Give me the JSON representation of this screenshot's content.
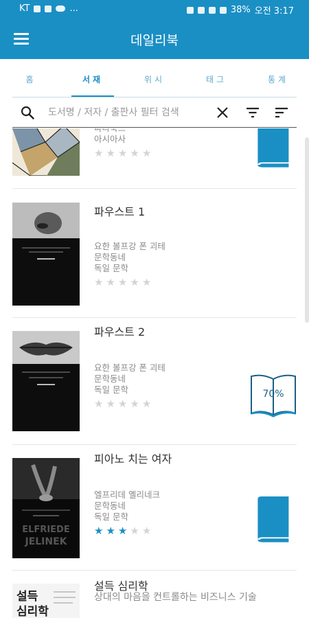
{
  "status": {
    "carrier": "KT",
    "more": "...",
    "battery": "38%",
    "time": "오전 3:17"
  },
  "app": {
    "title": "데일리북"
  },
  "tabs": [
    {
      "label": "홈",
      "active": false
    },
    {
      "label": "서재",
      "active": true
    },
    {
      "label": "위시",
      "active": false
    },
    {
      "label": "태그",
      "active": false
    },
    {
      "label": "통계",
      "active": false
    }
  ],
  "search": {
    "placeholder": "도서명 / 저자 / 출판사 필터 검색",
    "value": ""
  },
  "books": [
    {
      "title": "",
      "author": "파라북스",
      "publisher": "",
      "genre": "아시아사",
      "rating": 0,
      "status": "read-book-icon"
    },
    {
      "title": "파우스트 1",
      "author": "요한 볼프강 폰 괴테",
      "publisher": "문학동네",
      "genre": "독일 문학",
      "rating": 0,
      "status": ""
    },
    {
      "title": "파우스트 2",
      "author": "요한 볼프강 폰 괴테",
      "publisher": "문학동네",
      "genre": "독일 문학",
      "rating": 0,
      "status": "reading",
      "progress": "70%"
    },
    {
      "title": "피아노 치는 여자",
      "author": "엘프리데 옐리네크",
      "publisher": "문학동네",
      "genre": "독일 문학",
      "rating": 3,
      "status": "read-book-icon"
    },
    {
      "title": "설득 심리학",
      "subtitle": "상대의 마음을 컨트롤하는 비즈니스 기술"
    }
  ],
  "covers": {
    "book4_cover_text": "ELFRIEDE JELINEK",
    "book5_cover_text": "설득 심리학"
  },
  "colors": {
    "primary": "#1a8fc4",
    "star_on": "#1a8fc4",
    "star_off": "#d4d4d4"
  }
}
